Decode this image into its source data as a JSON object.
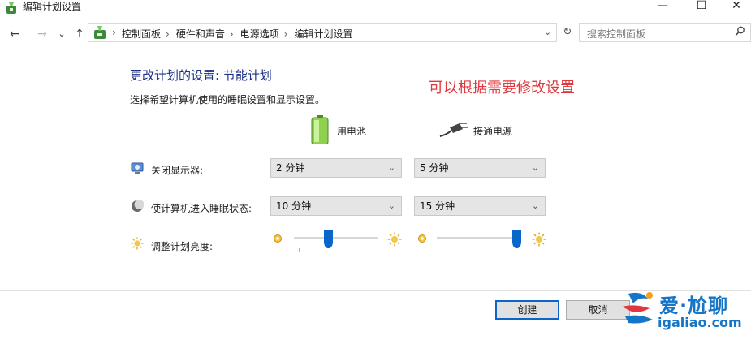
{
  "window": {
    "title": "编辑计划设置",
    "minimize_glyph": "—",
    "maximize_glyph": "☐",
    "close_glyph": "✕"
  },
  "nav": {
    "back_glyph": "←",
    "forward_glyph": "→",
    "recent_glyph": "⌄",
    "up_glyph": "↑"
  },
  "breadcrumb": {
    "items": [
      "控制面板",
      "硬件和声音",
      "电源选项",
      "编辑计划设置"
    ],
    "separator": "›",
    "dropdown_glyph": "⌄",
    "refresh_glyph": "↻"
  },
  "search": {
    "placeholder": "搜索控制面板",
    "icon": "search-icon"
  },
  "main": {
    "heading": "更改计划的设置: 节能计划",
    "subtext": "选择希望计算机使用的睡眠设置和显示设置。",
    "annotation": "可以根据需要修改设置"
  },
  "columns": {
    "battery": "用电池",
    "plugged": "接通电源"
  },
  "settings": {
    "display_off": {
      "label": "关闭显示器:",
      "battery": "2 分钟",
      "plugged": "5 分钟"
    },
    "sleep": {
      "label": "使计算机进入睡眠状态:",
      "battery": "10 分钟",
      "plugged": "15 分钟"
    },
    "brightness": {
      "label": "调整计划亮度:",
      "battery_level": 0.4,
      "plugged_level": 1.0
    }
  },
  "actions": {
    "create": "创建",
    "cancel": "取消"
  },
  "watermark": {
    "line1": "爱·尬聊",
    "line2": "igaliao.com"
  },
  "colors": {
    "heading": "#1e3287",
    "annotation": "#e0383e",
    "accent": "#0a66c8",
    "watermark": "#1576c8"
  }
}
